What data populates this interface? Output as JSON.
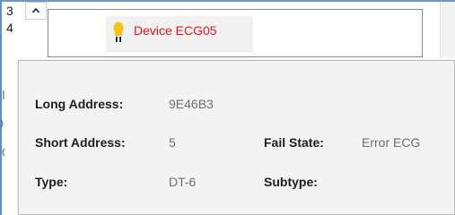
{
  "rows": {
    "first": "3",
    "second": "4"
  },
  "collapse_icon": "chevron-up-icon",
  "device": {
    "label": "Device ECG05",
    "label_color": "#e51a1a",
    "icon": "bulb-icon",
    "icon_color": "#f2c40f"
  },
  "tooltip": {
    "long_address_label": "Long Address:",
    "long_address_value": "9E46B3",
    "short_address_label": "Short Address:",
    "short_address_value": "5",
    "fail_state_label": "Fail State:",
    "fail_state_value": "Error ECG",
    "type_label": "Type:",
    "type_value": "DT-6",
    "subtype_label": "Subtype:",
    "subtype_value": ""
  }
}
